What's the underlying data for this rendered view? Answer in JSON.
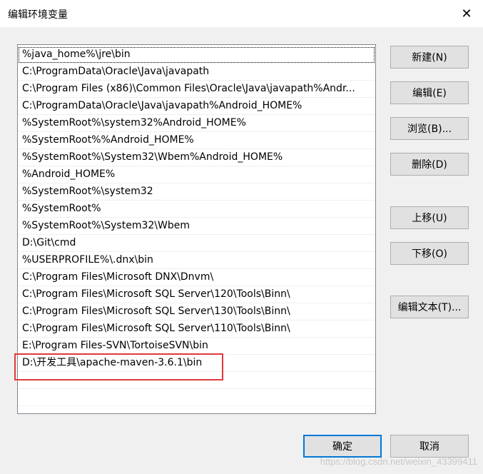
{
  "window": {
    "title": "编辑环境变量",
    "close_glyph": "✕"
  },
  "list": {
    "items": [
      "%java_home%\\jre\\bin",
      "C:\\ProgramData\\Oracle\\Java\\javapath",
      "C:\\Program Files (x86)\\Common Files\\Oracle\\Java\\javapath%Andr...",
      "C:\\ProgramData\\Oracle\\Java\\javapath%Android_HOME%",
      "%SystemRoot%\\system32%Android_HOME%",
      "%SystemRoot%%Android_HOME%",
      "%SystemRoot%\\System32\\Wbem%Android_HOME%",
      "%Android_HOME%",
      "%SystemRoot%\\system32",
      "%SystemRoot%",
      "%SystemRoot%\\System32\\Wbem",
      "D:\\Git\\cmd",
      "%USERPROFILE%\\.dnx\\bin",
      "C:\\Program Files\\Microsoft DNX\\Dnvm\\",
      "C:\\Program Files\\Microsoft SQL Server\\120\\Tools\\Binn\\",
      "C:\\Program Files\\Microsoft SQL Server\\130\\Tools\\Binn\\",
      "C:\\Program Files\\Microsoft SQL Server\\110\\Tools\\Binn\\",
      "E:\\Program Files-SVN\\TortoiseSVN\\bin",
      "D:\\开发工具\\apache-maven-3.6.1\\bin",
      "",
      ""
    ]
  },
  "buttons": {
    "new": "新建(N)",
    "edit": "编辑(E)",
    "browse": "浏览(B)...",
    "delete": "删除(D)",
    "move_up": "上移(U)",
    "move_down": "下移(O)",
    "edit_text": "编辑文本(T)...",
    "ok": "确定",
    "cancel": "取消"
  },
  "watermark": "https://blog.csdn.net/weixin_43399411",
  "colors": {
    "highlight_border": "#e0393e",
    "primary_border": "#0078d7"
  }
}
